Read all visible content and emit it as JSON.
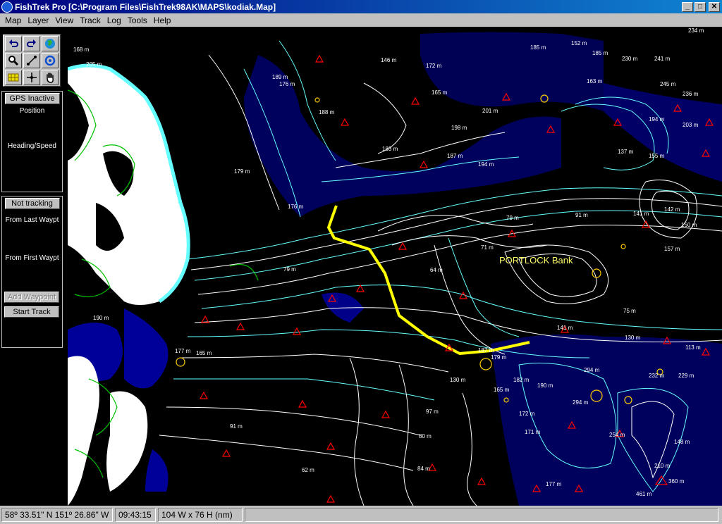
{
  "window": {
    "title": "FishTrek Pro [C:\\Program Files\\FishTrek98AK\\MAPS\\kodiak.Map]",
    "minimize": "_",
    "maximize": "□",
    "close": "✕"
  },
  "menu": [
    "Map",
    "Layer",
    "View",
    "Track",
    "Log",
    "Tools",
    "Help"
  ],
  "toolbox": {
    "tools": [
      "undo-icon",
      "redo-icon",
      "globe-icon",
      "zoom-in-icon",
      "measure-icon",
      "refresh-icon",
      "grid-icon",
      "crosshair-icon",
      "hand-icon"
    ]
  },
  "gps": {
    "status_button": "GPS Inactive",
    "position_label": "Position",
    "heading_label": "Heading/Speed"
  },
  "tracking": {
    "status_button": "Not tracking",
    "from_last_label": "From Last Waypt",
    "from_first_label": "From First Waypt",
    "add_waypoint_button": "Add Waypoint",
    "start_track_button": "Start Track"
  },
  "map": {
    "bank_label": "PORTLOCK Bank",
    "colors": {
      "water": "#000000",
      "land": "#ffffff",
      "deep": "#0000aa",
      "shallow": "#66ffff",
      "coast": "#00c000",
      "track": "#ffff00",
      "marker": "#ff0000"
    },
    "depth_labels": [
      "168 m",
      "205 m",
      "189 m",
      "176 m",
      "146 m",
      "172 m",
      "185 m",
      "152 m",
      "185 m",
      "230 m",
      "241 m",
      "234 m",
      "165 m",
      "201 m",
      "163 m",
      "245 m",
      "236 m",
      "188 m",
      "198 m",
      "194 m",
      "203 m",
      "183 m",
      "187 m",
      "194 m",
      "137 m",
      "155 m",
      "179 m",
      "176 m",
      "79 m",
      "91 m",
      "141 m",
      "142 m",
      "150 m",
      "71 m",
      "64 m",
      "157 m",
      "75 m",
      "113 m",
      "130 m",
      "141 m",
      "187 m",
      "179 m",
      "294 m",
      "232 m",
      "229 m",
      "182 m",
      "190 m",
      "165 m",
      "172 m",
      "171 m",
      "294 m",
      "254 m",
      "148 m",
      "210 m",
      "360 m",
      "461 m",
      "177 m",
      "97 m",
      "80 m",
      "62 m",
      "91 m",
      "84 m",
      "130 m",
      "79 m",
      "177 m",
      "165 m",
      "190 m"
    ]
  },
  "status": {
    "position": "58º 33.51\" N 151º 26.86\" W",
    "time": "09:43:15",
    "extent": "104 W x 76 H (nm)"
  }
}
